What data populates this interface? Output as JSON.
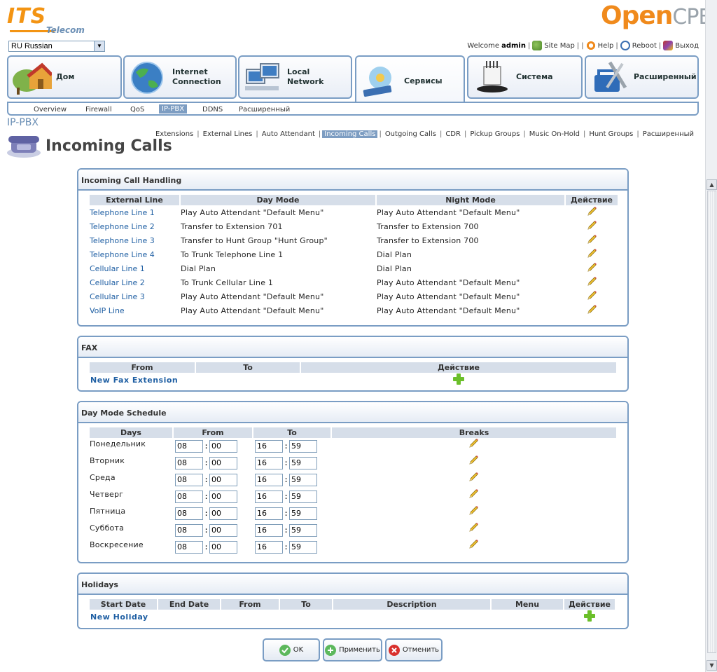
{
  "header": {
    "its_logo": "ITS",
    "its_logo_sub": "Telecom",
    "opencpe_logo": "Open",
    "opencpe_logo_suffix": "CPE",
    "language": "RU Russian",
    "welcome": "Welcome",
    "username": "admin",
    "links": {
      "sitemap": "Site Map",
      "help": "Help",
      "reboot": "Reboot",
      "logout": "Выход"
    }
  },
  "main_tabs": [
    {
      "label": "Дом"
    },
    {
      "label": "Internet\nConnection"
    },
    {
      "label": "Local\nNetwork"
    },
    {
      "label": "Сервисы"
    },
    {
      "label": "Система"
    },
    {
      "label": "Расширенный"
    }
  ],
  "subnav": [
    "Overview",
    "Firewall",
    "QoS",
    "IP-PBX",
    "DDNS",
    "Расширенный"
  ],
  "section_title": "IP-PBX",
  "page_title": "Incoming Calls",
  "subsubnav": [
    "Extensions",
    "External Lines",
    "Auto Attendant",
    "Incoming Calls",
    "Outgoing Calls",
    "CDR",
    "Pickup Groups",
    "Music On-Hold",
    "Hunt Groups",
    "Расширенный"
  ],
  "incoming": {
    "title": "Incoming Call Handling",
    "headers": [
      "External Line",
      "Day Mode",
      "Night Mode",
      "Действие"
    ],
    "rows": [
      {
        "line": "Telephone Line 1",
        "day": "Play Auto Attendant \"Default Menu\"",
        "night": "Play Auto Attendant \"Default Menu\""
      },
      {
        "line": "Telephone Line 2",
        "day": "Transfer to Extension 701",
        "night": "Transfer to Extension 700"
      },
      {
        "line": "Telephone Line 3",
        "day": "Transfer to Hunt Group \"Hunt Group\"",
        "night": "Transfer to Extension 700"
      },
      {
        "line": "Telephone Line 4",
        "day": "To Trunk Telephone Line 1",
        "night": "Dial Plan"
      },
      {
        "line": "Cellular Line 1",
        "day": "Dial Plan",
        "night": "Dial Plan"
      },
      {
        "line": "Cellular Line 2",
        "day": "To Trunk Cellular Line 1",
        "night": "Play Auto Attendant \"Default Menu\""
      },
      {
        "line": "Cellular Line 3",
        "day": "Play Auto Attendant \"Default Menu\"",
        "night": "Play Auto Attendant \"Default Menu\""
      },
      {
        "line": "VoIP Line",
        "day": "Play Auto Attendant \"Default Menu\"",
        "night": "Play Auto Attendant \"Default Menu\""
      }
    ]
  },
  "fax": {
    "title": "FAX",
    "headers": [
      "From",
      "To",
      "Действие"
    ],
    "new_link": "New Fax Extension"
  },
  "schedule": {
    "title": "Day Mode Schedule",
    "headers": [
      "Days",
      "From",
      "To",
      "Breaks"
    ],
    "rows": [
      {
        "day": "Понедельник",
        "from_h": "08",
        "from_m": "00",
        "to_h": "16",
        "to_m": "59"
      },
      {
        "day": "Вторник",
        "from_h": "08",
        "from_m": "00",
        "to_h": "16",
        "to_m": "59"
      },
      {
        "day": "Среда",
        "from_h": "08",
        "from_m": "00",
        "to_h": "16",
        "to_m": "59"
      },
      {
        "day": "Четверг",
        "from_h": "08",
        "from_m": "00",
        "to_h": "16",
        "to_m": "59"
      },
      {
        "day": "Пятница",
        "from_h": "08",
        "from_m": "00",
        "to_h": "16",
        "to_m": "59"
      },
      {
        "day": "Суббота",
        "from_h": "08",
        "from_m": "00",
        "to_h": "16",
        "to_m": "59"
      },
      {
        "day": "Воскресение",
        "from_h": "08",
        "from_m": "00",
        "to_h": "16",
        "to_m": "59"
      }
    ]
  },
  "holidays": {
    "title": "Holidays",
    "headers": [
      "Start Date",
      "End Date",
      "From",
      "To",
      "Description",
      "Menu",
      "Действие"
    ],
    "new_link": "New Holiday"
  },
  "buttons": {
    "ok": "OK",
    "apply": "Применить",
    "cancel": "Отменить"
  },
  "colors": {
    "accent": "#7a9dc4",
    "link": "#1f5fa3",
    "brand_orange": "#f39413"
  }
}
